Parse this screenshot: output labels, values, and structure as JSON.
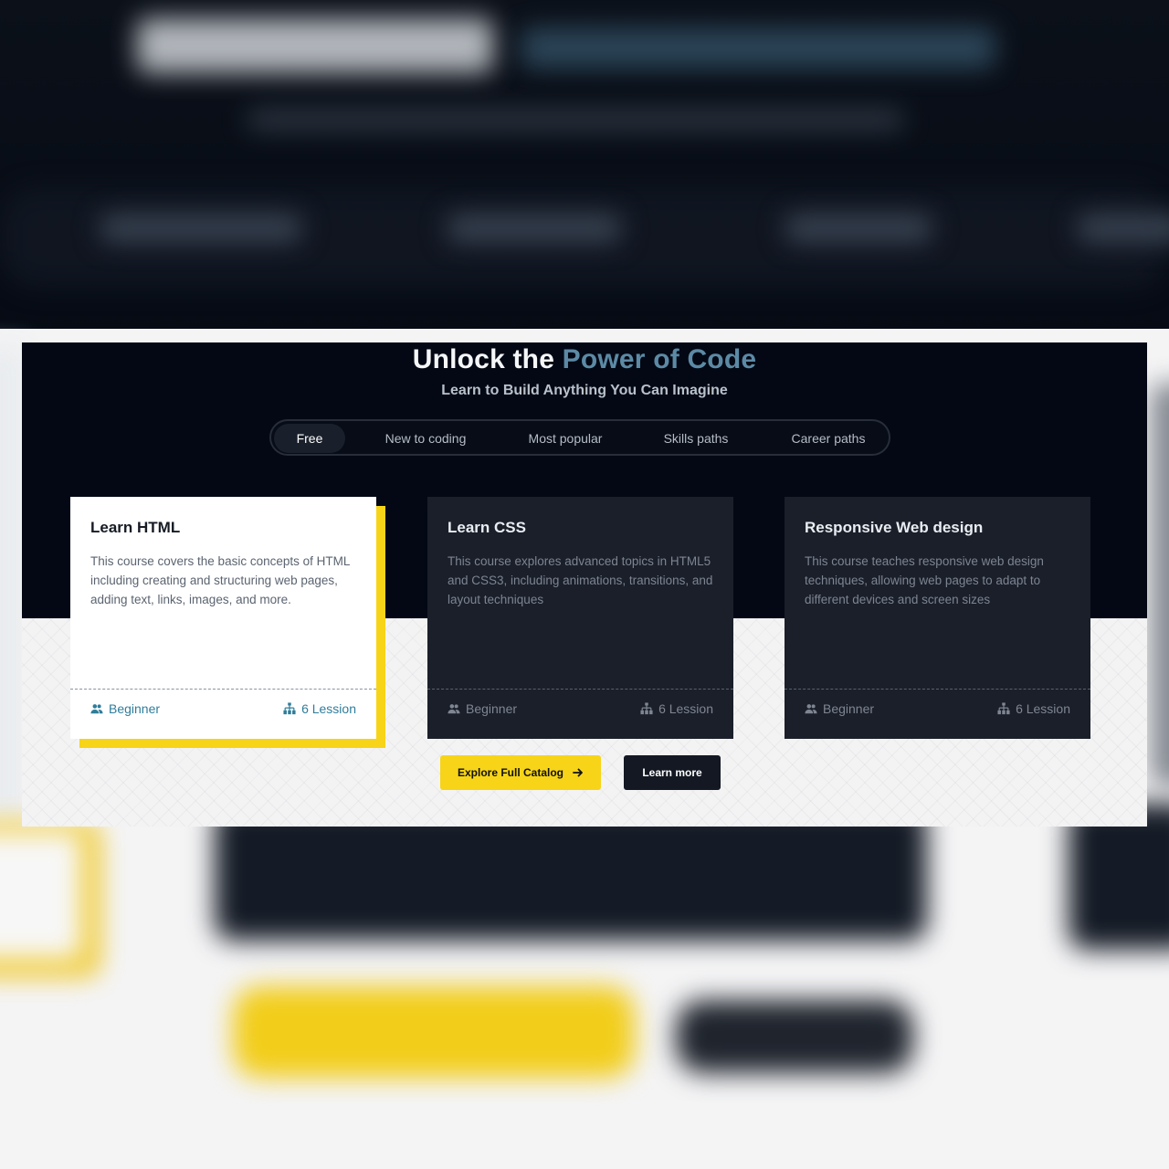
{
  "hero": {
    "title_prefix": "Unlock the ",
    "title_accent": "Power of Code",
    "subtitle": "Learn to Build Anything You Can Imagine"
  },
  "tabs": [
    {
      "label": "Free",
      "active": true
    },
    {
      "label": "New to coding",
      "active": false
    },
    {
      "label": "Most popular",
      "active": false
    },
    {
      "label": "Skills paths",
      "active": false
    },
    {
      "label": "Career paths",
      "active": false
    }
  ],
  "courses": [
    {
      "title": "Learn HTML",
      "description": "This course covers the basic concepts of HTML including creating and structuring web pages, adding text, links, images, and more.",
      "level": "Beginner",
      "lessons": "6 Lession",
      "highlighted": true
    },
    {
      "title": "Learn CSS",
      "description": "This course explores advanced topics in HTML5 and CSS3, including animations, transitions, and layout techniques",
      "level": "Beginner",
      "lessons": "6 Lession",
      "highlighted": false
    },
    {
      "title": "Responsive Web design",
      "description": "This course teaches responsive web design techniques, allowing web pages to adapt to different devices and screen sizes",
      "level": "Beginner",
      "lessons": "6 Lession",
      "highlighted": false
    }
  ],
  "actions": {
    "explore_label": "Explore Full Catalog",
    "learn_more_label": "Learn more"
  },
  "colors": {
    "accent_blue": "#5c8aa5",
    "accent_yellow": "#f7d417",
    "dark_bg": "#030814",
    "card_dark": "#1a1f2a"
  },
  "icons": {
    "level": "users-icon",
    "lessons": "sitemap-icon",
    "explore": "arrow-right-icon"
  }
}
